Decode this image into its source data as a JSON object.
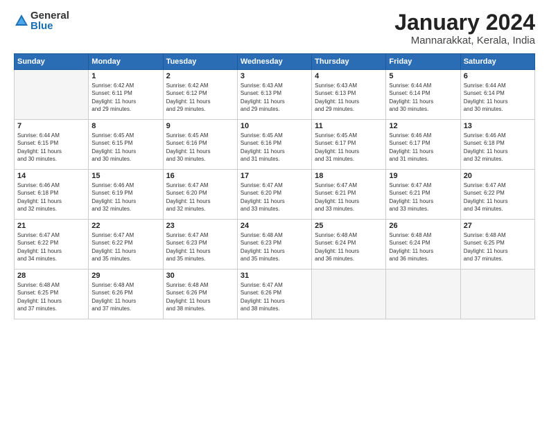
{
  "header": {
    "logo_general": "General",
    "logo_blue": "Blue",
    "month_title": "January 2024",
    "subtitle": "Mannarakkat, Kerala, India"
  },
  "days_of_week": [
    "Sunday",
    "Monday",
    "Tuesday",
    "Wednesday",
    "Thursday",
    "Friday",
    "Saturday"
  ],
  "weeks": [
    [
      {
        "day": "",
        "info": ""
      },
      {
        "day": "1",
        "info": "Sunrise: 6:42 AM\nSunset: 6:11 PM\nDaylight: 11 hours\nand 29 minutes."
      },
      {
        "day": "2",
        "info": "Sunrise: 6:42 AM\nSunset: 6:12 PM\nDaylight: 11 hours\nand 29 minutes."
      },
      {
        "day": "3",
        "info": "Sunrise: 6:43 AM\nSunset: 6:13 PM\nDaylight: 11 hours\nand 29 minutes."
      },
      {
        "day": "4",
        "info": "Sunrise: 6:43 AM\nSunset: 6:13 PM\nDaylight: 11 hours\nand 29 minutes."
      },
      {
        "day": "5",
        "info": "Sunrise: 6:44 AM\nSunset: 6:14 PM\nDaylight: 11 hours\nand 30 minutes."
      },
      {
        "day": "6",
        "info": "Sunrise: 6:44 AM\nSunset: 6:14 PM\nDaylight: 11 hours\nand 30 minutes."
      }
    ],
    [
      {
        "day": "7",
        "info": "Sunrise: 6:44 AM\nSunset: 6:15 PM\nDaylight: 11 hours\nand 30 minutes."
      },
      {
        "day": "8",
        "info": "Sunrise: 6:45 AM\nSunset: 6:15 PM\nDaylight: 11 hours\nand 30 minutes."
      },
      {
        "day": "9",
        "info": "Sunrise: 6:45 AM\nSunset: 6:16 PM\nDaylight: 11 hours\nand 30 minutes."
      },
      {
        "day": "10",
        "info": "Sunrise: 6:45 AM\nSunset: 6:16 PM\nDaylight: 11 hours\nand 31 minutes."
      },
      {
        "day": "11",
        "info": "Sunrise: 6:45 AM\nSunset: 6:17 PM\nDaylight: 11 hours\nand 31 minutes."
      },
      {
        "day": "12",
        "info": "Sunrise: 6:46 AM\nSunset: 6:17 PM\nDaylight: 11 hours\nand 31 minutes."
      },
      {
        "day": "13",
        "info": "Sunrise: 6:46 AM\nSunset: 6:18 PM\nDaylight: 11 hours\nand 32 minutes."
      }
    ],
    [
      {
        "day": "14",
        "info": "Sunrise: 6:46 AM\nSunset: 6:18 PM\nDaylight: 11 hours\nand 32 minutes."
      },
      {
        "day": "15",
        "info": "Sunrise: 6:46 AM\nSunset: 6:19 PM\nDaylight: 11 hours\nand 32 minutes."
      },
      {
        "day": "16",
        "info": "Sunrise: 6:47 AM\nSunset: 6:20 PM\nDaylight: 11 hours\nand 32 minutes."
      },
      {
        "day": "17",
        "info": "Sunrise: 6:47 AM\nSunset: 6:20 PM\nDaylight: 11 hours\nand 33 minutes."
      },
      {
        "day": "18",
        "info": "Sunrise: 6:47 AM\nSunset: 6:21 PM\nDaylight: 11 hours\nand 33 minutes."
      },
      {
        "day": "19",
        "info": "Sunrise: 6:47 AM\nSunset: 6:21 PM\nDaylight: 11 hours\nand 33 minutes."
      },
      {
        "day": "20",
        "info": "Sunrise: 6:47 AM\nSunset: 6:22 PM\nDaylight: 11 hours\nand 34 minutes."
      }
    ],
    [
      {
        "day": "21",
        "info": "Sunrise: 6:47 AM\nSunset: 6:22 PM\nDaylight: 11 hours\nand 34 minutes."
      },
      {
        "day": "22",
        "info": "Sunrise: 6:47 AM\nSunset: 6:22 PM\nDaylight: 11 hours\nand 35 minutes."
      },
      {
        "day": "23",
        "info": "Sunrise: 6:47 AM\nSunset: 6:23 PM\nDaylight: 11 hours\nand 35 minutes."
      },
      {
        "day": "24",
        "info": "Sunrise: 6:48 AM\nSunset: 6:23 PM\nDaylight: 11 hours\nand 35 minutes."
      },
      {
        "day": "25",
        "info": "Sunrise: 6:48 AM\nSunset: 6:24 PM\nDaylight: 11 hours\nand 36 minutes."
      },
      {
        "day": "26",
        "info": "Sunrise: 6:48 AM\nSunset: 6:24 PM\nDaylight: 11 hours\nand 36 minutes."
      },
      {
        "day": "27",
        "info": "Sunrise: 6:48 AM\nSunset: 6:25 PM\nDaylight: 11 hours\nand 37 minutes."
      }
    ],
    [
      {
        "day": "28",
        "info": "Sunrise: 6:48 AM\nSunset: 6:25 PM\nDaylight: 11 hours\nand 37 minutes."
      },
      {
        "day": "29",
        "info": "Sunrise: 6:48 AM\nSunset: 6:26 PM\nDaylight: 11 hours\nand 37 minutes."
      },
      {
        "day": "30",
        "info": "Sunrise: 6:48 AM\nSunset: 6:26 PM\nDaylight: 11 hours\nand 38 minutes."
      },
      {
        "day": "31",
        "info": "Sunrise: 6:47 AM\nSunset: 6:26 PM\nDaylight: 11 hours\nand 38 minutes."
      },
      {
        "day": "",
        "info": ""
      },
      {
        "day": "",
        "info": ""
      },
      {
        "day": "",
        "info": ""
      }
    ]
  ]
}
